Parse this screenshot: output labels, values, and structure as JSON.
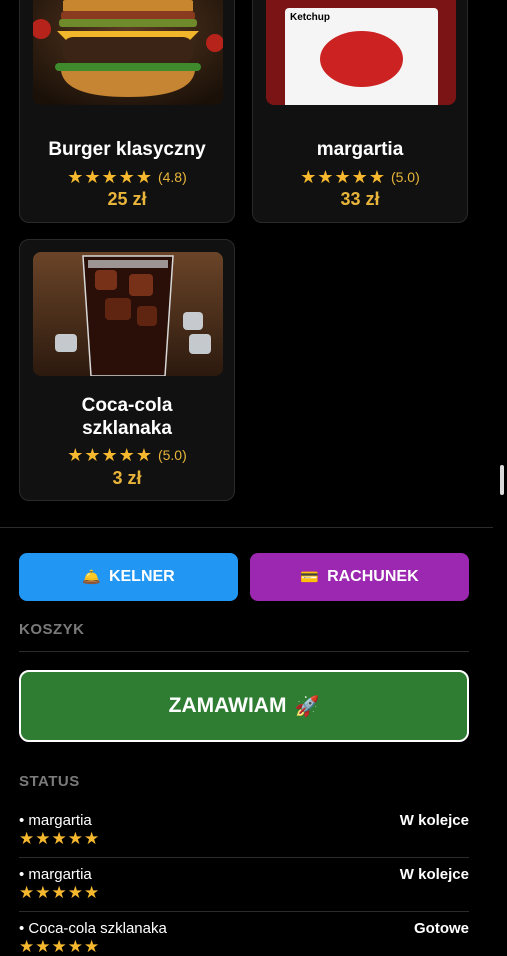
{
  "menu": {
    "items": [
      {
        "name": "Burger klasyczny",
        "rating": "(4.8)",
        "price": "25 zł",
        "stars": 5
      },
      {
        "name": "margartia",
        "rating": "(5.0)",
        "price": "33 zł",
        "stars": 5,
        "image_text": "Ketchup"
      },
      {
        "name": "Coca-cola szklanaka",
        "rating": "(5.0)",
        "price": "3 zł",
        "stars": 5
      }
    ]
  },
  "actions": {
    "waiter_label": "KELNER",
    "bill_label": "RACHUNEK",
    "waiter_color": "#2196f3",
    "bill_color": "#9c27b0"
  },
  "cart": {
    "label": "KOSZYK",
    "order_label": "ZAMAWIAM",
    "order_color": "#2e7d32"
  },
  "status": {
    "label": "STATUS",
    "orders": [
      {
        "item": "• margartia",
        "state": "W kolejce"
      },
      {
        "item": "• margartia",
        "state": "W kolejce"
      },
      {
        "item": "• Coca-cola szklanaka",
        "state": "Gotowe"
      }
    ]
  },
  "icons": {
    "star": "star-icon",
    "waiter": "bell-icon",
    "bill": "card-icon",
    "order": "rocket-icon"
  },
  "colors": {
    "accent": "#e8b53a",
    "star": "#f5b82e"
  }
}
